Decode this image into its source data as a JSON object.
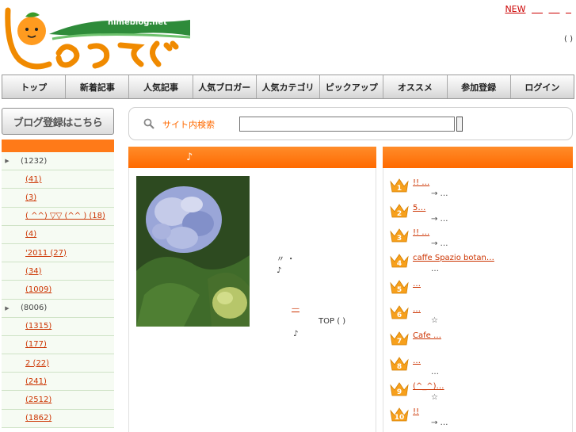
{
  "header": {
    "logo_text": "himeblog.net",
    "top_links": [
      "NEW",
      "",
      "",
      ""
    ],
    "top_paren": "( )"
  },
  "nav": [
    {
      "label": "トップ"
    },
    {
      "label": "新着記事"
    },
    {
      "label": "人気記事"
    },
    {
      "label": "人気ブロガー"
    },
    {
      "label": "人気カテゴリ"
    },
    {
      "label": "ピックアップ"
    },
    {
      "label": "オススメ"
    },
    {
      "label": "参加登録"
    },
    {
      "label": "ログイン"
    }
  ],
  "sidebar": {
    "register_banner": "ブログ登録はこちら",
    "categories": [
      {
        "label": "(1232)",
        "arrow": true,
        "link": false
      },
      {
        "label": "(41)",
        "arrow": false,
        "link": true
      },
      {
        "label": "(3)",
        "arrow": false,
        "link": true
      },
      {
        "label": "( ^^) ▽▽ (^^ )  (18)",
        "arrow": false,
        "link": true
      },
      {
        "label": "(4)",
        "arrow": false,
        "link": true
      },
      {
        "label": "'2011 (27)",
        "arrow": false,
        "link": true
      },
      {
        "label": "(34)",
        "arrow": false,
        "link": true
      },
      {
        "label": "(1009)",
        "arrow": false,
        "link": true
      },
      {
        "label": "(8006)",
        "arrow": true,
        "link": false
      },
      {
        "label": "(1315)",
        "arrow": false,
        "link": true
      },
      {
        "label": "(177)",
        "arrow": false,
        "link": true
      },
      {
        "label": "2      (22)",
        "arrow": false,
        "link": true
      },
      {
        "label": "(241)",
        "arrow": false,
        "link": true
      },
      {
        "label": "(2512)",
        "arrow": false,
        "link": true
      },
      {
        "label": "(1862)",
        "arrow": false,
        "link": true
      }
    ]
  },
  "search": {
    "label": "サイト内検索",
    "value": ""
  },
  "article": {
    "title": "♪",
    "lines": [
      "〃 ・",
      "♪",
      "",
      "—",
      "TOP  (    )",
      "♪"
    ]
  },
  "ranking": [
    {
      "rank": "1",
      "title": "!!  …",
      "sub": "→ …"
    },
    {
      "rank": "2",
      "title": "5…",
      "sub": "→ …"
    },
    {
      "rank": "3",
      "title": "!!   …",
      "sub": "→ …"
    },
    {
      "rank": "4",
      "title": "caffe Spazio botan…",
      "sub": "…"
    },
    {
      "rank": "5",
      "title": "…",
      "sub": ""
    },
    {
      "rank": "6",
      "title": "…",
      "sub": "☆"
    },
    {
      "rank": "7",
      "title": "Cafe       …",
      "sub": ""
    },
    {
      "rank": "8",
      "title": "…",
      "sub": "…"
    },
    {
      "rank": "9",
      "title": "(^_^)…",
      "sub": "☆"
    },
    {
      "rank": "10",
      "title": "!!",
      "sub": "→ …"
    }
  ],
  "colors": {
    "accent": "#ff6a00",
    "link": "#cc3300",
    "crown": "#f7a01c"
  }
}
